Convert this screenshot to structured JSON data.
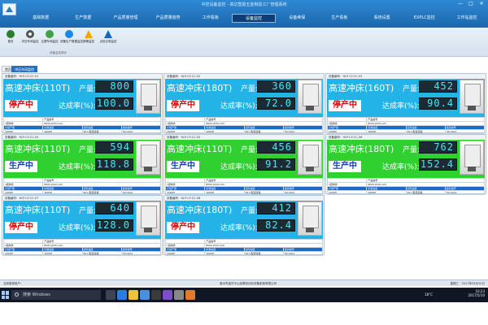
{
  "window": {
    "title": "中控设备监控 - 高达塑胶五金制造工厂管理系统",
    "controls": [
      "—",
      "□",
      "✕"
    ]
  },
  "menu": {
    "items": [
      "基础数据",
      "生产数据",
      "产品质量管理",
      "产品质量趋势",
      "工作看板",
      "设备监控",
      "设备维保",
      "生产看板",
      "系统设置",
      "EXPLC监控",
      "工作站监控"
    ],
    "active_index": 5
  },
  "toolbar": {
    "buttons": [
      {
        "label": "首页",
        "icon": "back-icon"
      },
      {
        "label": "冲压车间监控",
        "icon": "gear-icon"
      },
      {
        "label": "注塑车间监控",
        "icon": "green-circle-icon"
      },
      {
        "label": "设备生产数据监控",
        "icon": "blue-circle-icon"
      },
      {
        "label": "报警监控",
        "icon": "warning-icon"
      },
      {
        "label": "点检记录监控",
        "icon": "info-icon"
      }
    ],
    "group_label": "设备监控操作"
  },
  "tabs": [
    {
      "label": "首页",
      "active": false
    },
    {
      "label": "冲压车间监控",
      "active": true
    }
  ],
  "table_labels": {
    "product_code": "产品编号",
    "product_name": "产品名称",
    "plan_qty": "计划产量",
    "std_speed": "标准速度",
    "actual_speed": "实际速度",
    "mold_no": "模具编号"
  },
  "labels": {
    "qty": "产量:",
    "rate": "达成率(%):"
  },
  "cards": [
    {
      "id": "设备编号：HLP-CY-CC-01",
      "name": "高速冲床(110T)",
      "status": "停产中",
      "state": "stopped",
      "qty": "800",
      "rate": "100.0",
      "code": "1结构件",
      "pname": "800U-JP20-120",
      "plan": "1000H",
      "std": "1000H",
      "speed": "20-U型连接板",
      "mold": "30-UL01"
    },
    {
      "id": "设备编号：HLP-CY-CC-02",
      "name": "高速冲床(180T)",
      "status": "停产中",
      "state": "stopped",
      "qty": "360",
      "rate": "72.0",
      "code": "1结构件",
      "pname": "800U-JP20-120",
      "plan": "1000H",
      "std": "1000H",
      "speed": "20-U型连接板",
      "mold": "30-UL01"
    },
    {
      "id": "设备编号：HLP-CY-CC-03",
      "name": "高速冲床(160T)",
      "status": "停产中",
      "state": "stopped",
      "qty": "452",
      "rate": "90.4",
      "code": "1结构件",
      "pname": "800U-JP20-120",
      "plan": "1000H",
      "std": "1000H",
      "speed": "20-U型连接板",
      "mold": "30-UL01"
    },
    {
      "id": "设备编号：HLP-CY-CC-04",
      "name": "高速冲床(110T)",
      "status": "生产中",
      "state": "running",
      "qty": "594",
      "rate": "118.8",
      "code": "1结构件",
      "pname": "800U-JP20-120",
      "plan": "1000H",
      "std": "1000H",
      "speed": "20-U型连接板",
      "mold": "30-UL01"
    },
    {
      "id": "设备编号：HLP-CY-CC-05",
      "name": "高速冲床(110T)",
      "status": "生产中",
      "state": "running",
      "qty": "456",
      "rate": "91.2",
      "code": "1结构件",
      "pname": "800U-JP20-120",
      "plan": "1000H",
      "std": "1000H",
      "speed": "20-U型连接板",
      "mold": "30-UL01"
    },
    {
      "id": "设备编号：HLP-CY-CC-06",
      "name": "高速冲床(180T)",
      "status": "生产中",
      "state": "running",
      "qty": "762",
      "rate": "152.4",
      "code": "1结构件",
      "pname": "800U-JP20-120",
      "plan": "1000H",
      "std": "1000H",
      "speed": "20-U型连接板",
      "mold": "30-UL01"
    },
    {
      "id": "设备编号：HLP-CY-CC-07",
      "name": "高速冲床(110T)",
      "status": "停产中",
      "state": "stopped",
      "qty": "640",
      "rate": "128.0",
      "code": "1结构件",
      "pname": "800U-JP20-120",
      "plan": "1000H",
      "std": "1000H",
      "speed": "20-U型连接板",
      "mold": "30-UL01"
    },
    {
      "id": "设备编号：HLP-CY-CC-08",
      "name": "高速冲床(180T)",
      "status": "停产中",
      "state": "stopped",
      "qty": "412",
      "rate": "82.4",
      "code": "1结构件",
      "pname": "800U-JP20-120",
      "plan": "1000H",
      "std": "1000H",
      "speed": "20-U型连接板",
      "mold": "30-UL01"
    }
  ],
  "statusbar": {
    "left": "当前登录用户：",
    "center": "惠州市高华中心品牌自动化设备制造有限公司",
    "right": "星期三　2017年05月10日"
  },
  "taskbar": {
    "search_placeholder": "搜索 Windows",
    "apps": [
      "task-view-icon",
      "edge-icon",
      "explorer-icon",
      "store-icon",
      "terminal-icon",
      "visual-studio-icon",
      "settings-icon",
      "app-icon"
    ],
    "app_colors": [
      "#3c4352",
      "#2c7be5",
      "#f0c239",
      "#4a90e2",
      "#3b3b3b",
      "#7c4dcc",
      "#888888",
      "#e27a2c"
    ],
    "temperature": "18°C",
    "time": "10:23",
    "date": "2017/5/10"
  }
}
